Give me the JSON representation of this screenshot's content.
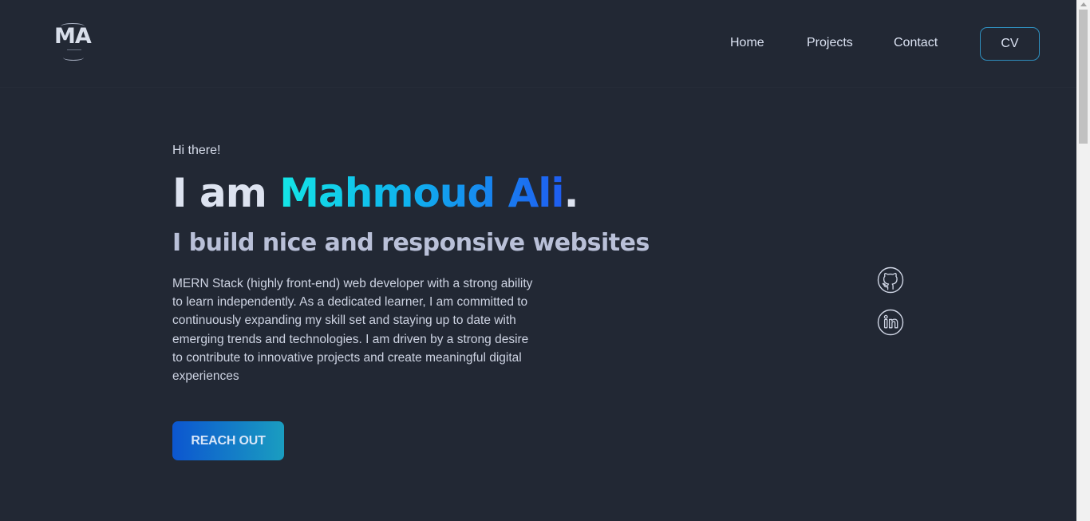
{
  "header": {
    "logo_text": "MA",
    "nav": [
      {
        "label": "Home"
      },
      {
        "label": "Projects"
      },
      {
        "label": "Contact"
      }
    ],
    "cv_label": "CV"
  },
  "hero": {
    "greeting": "Hi there!",
    "headline_prefix": "I am ",
    "name": "Mahmoud Ali",
    "headline_suffix": ".",
    "tagline": "I build nice and responsive websites",
    "bio": "MERN Stack (highly front-end) web developer with a strong ability to learn independently. As a dedicated learner, I am committed to continuously expanding my skill set and staying up to date with emerging trends and technologies. I am driven by a strong desire to contribute to innovative projects and create meaningful digital experiences",
    "cta_label": "REACH OUT"
  },
  "social": [
    {
      "icon": "github-icon"
    },
    {
      "icon": "linkedin-icon"
    }
  ],
  "colors": {
    "background": "#222834",
    "accent_start": "#14e6e6",
    "accent_end": "#1f5cf0",
    "cta_start": "#0c56d0",
    "cta_end": "#1a9dc0",
    "cv_border": "#2f8fbf"
  }
}
